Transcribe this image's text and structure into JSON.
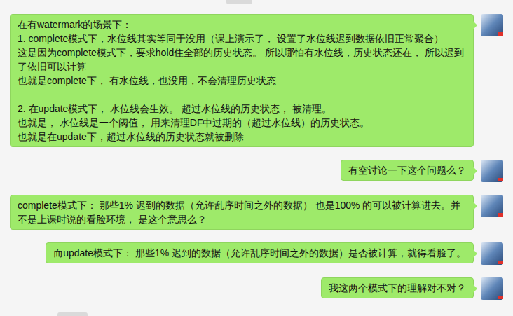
{
  "messages": [
    {
      "text": "在有watermark的场景下：\n1. complete模式下，水位线其实等同于没用（课上演示了， 设置了水位线迟到数据依旧正常聚合）\n这是因为complete模式下，要求hold住全部的历史状态。 所以哪怕有水位线，历史状态还在， 所以迟到了依旧可以计算\n也就是complete下， 有水位线，也没用，不会清理历史状态\n\n2. 在update模式下， 水位线会生效。 超过水位线的历史状态， 被清理。\n也就是， 水位线是一个阈值， 用来清理DF中过期的（超过水位线）的历史状态。\n也就是在update下，超过水位线的历史状态就被删除"
    },
    {
      "text": "有空讨论一下这个问题么？"
    },
    {
      "text": "complete模式下： 那些1% 迟到的数据（允许乱序时间之外的数据） 也是100% 的可以被计算进去。并不是上课时说的看脸环境， 是这个意思么？"
    },
    {
      "text": "而update模式下： 那些1% 迟到的数据（允许乱序时间之外的数据）是否被计算，就得看脸了。"
    },
    {
      "text": "我这两个模式下的理解对不对？"
    }
  ]
}
